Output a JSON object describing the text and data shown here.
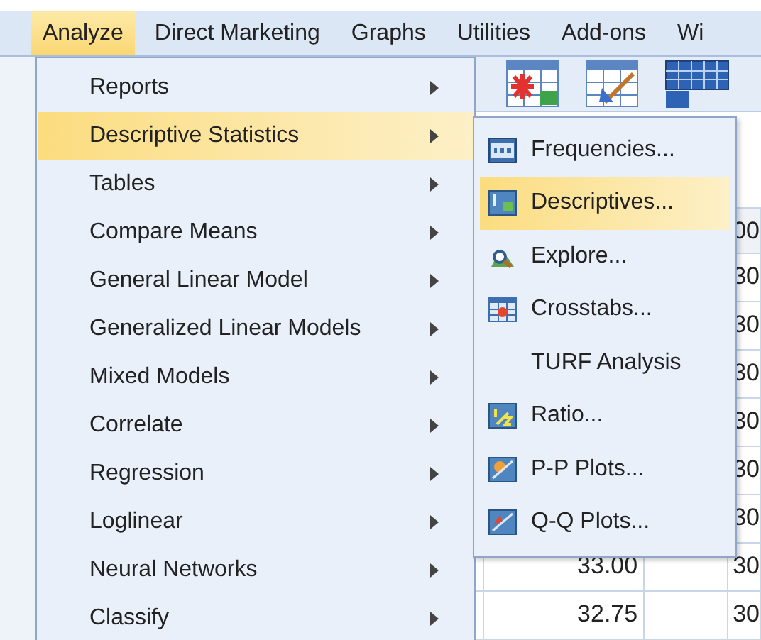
{
  "menu_bar": [
    {
      "label": "Analyze",
      "selected": true
    },
    {
      "label": "Direct Marketing",
      "selected": false
    },
    {
      "label": "Graphs",
      "selected": false
    },
    {
      "label": "Utilities",
      "selected": false
    },
    {
      "label": "Add-ons",
      "selected": false
    },
    {
      "label": "Wi",
      "selected": false
    }
  ],
  "analyze_menu": [
    {
      "label": "Reports",
      "submenu": true,
      "selected": false
    },
    {
      "label": "Descriptive Statistics",
      "submenu": true,
      "selected": true
    },
    {
      "label": "Tables",
      "submenu": true,
      "selected": false
    },
    {
      "label": "Compare Means",
      "submenu": true,
      "selected": false
    },
    {
      "label": "General Linear Model",
      "submenu": true,
      "selected": false
    },
    {
      "label": "Generalized Linear Models",
      "submenu": true,
      "selected": false
    },
    {
      "label": "Mixed Models",
      "submenu": true,
      "selected": false
    },
    {
      "label": "Correlate",
      "submenu": true,
      "selected": false
    },
    {
      "label": "Regression",
      "submenu": true,
      "selected": false
    },
    {
      "label": "Loglinear",
      "submenu": true,
      "selected": false
    },
    {
      "label": "Neural Networks",
      "submenu": true,
      "selected": false
    },
    {
      "label": "Classify",
      "submenu": true,
      "selected": false
    }
  ],
  "descriptive_statistics_menu": [
    {
      "label": "Frequencies...",
      "kind": "numbers",
      "selected": false
    },
    {
      "label": "Descriptives...",
      "kind": "mu",
      "selected": true
    },
    {
      "label": "Explore...",
      "kind": "magnifier",
      "selected": false
    },
    {
      "label": "Crosstabs...",
      "kind": "grid",
      "selected": false
    },
    {
      "label": "TURF Analysis",
      "kind": "plain",
      "selected": false
    },
    {
      "label": "Ratio...",
      "kind": "fraction",
      "selected": false
    },
    {
      "label": "P-P Plots...",
      "kind": "pp",
      "selected": false
    },
    {
      "label": "Q-Q Plots...",
      "kind": "qq",
      "selected": false
    }
  ],
  "data_grid": {
    "header": {
      "column_4": "00"
    },
    "rows": [
      {
        "column_4": "30"
      },
      {
        "column_4": "30"
      },
      {
        "column_4": "30"
      },
      {
        "column_4": "30"
      },
      {
        "column_4": "30"
      },
      {
        "column_4": "30"
      },
      {
        "column_2": "33.00",
        "column_4": "30"
      },
      {
        "column_2": "32.75",
        "column_4": "30"
      }
    ]
  }
}
